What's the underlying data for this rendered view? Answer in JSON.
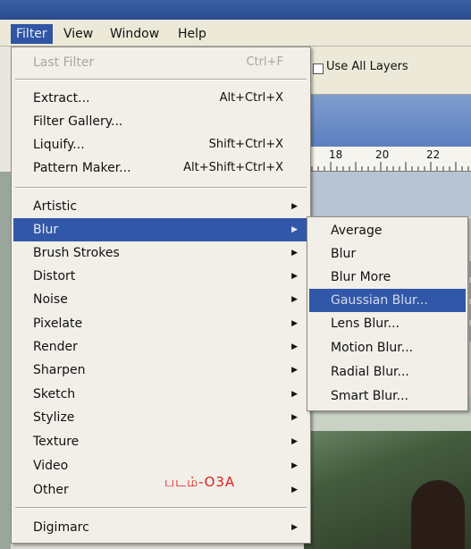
{
  "menubar": {
    "items": [
      "Filter",
      "View",
      "Window",
      "Help"
    ],
    "active": "Filter"
  },
  "options": {
    "use_all_layers": "Use All Layers"
  },
  "ruler": {
    "labels": [
      "18",
      "20",
      "22"
    ]
  },
  "filter_menu": {
    "last_filter": {
      "label": "Last Filter",
      "shortcut": "Ctrl+F"
    },
    "group1": [
      {
        "label": "Extract...",
        "shortcut": "Alt+Ctrl+X"
      },
      {
        "label": "Filter Gallery...",
        "shortcut": ""
      },
      {
        "label": "Liquify...",
        "shortcut": "Shift+Ctrl+X"
      },
      {
        "label": "Pattern Maker...",
        "shortcut": "Alt+Shift+Ctrl+X"
      }
    ],
    "group2": [
      {
        "label": "Artistic"
      },
      {
        "label": "Blur"
      },
      {
        "label": "Brush Strokes"
      },
      {
        "label": "Distort"
      },
      {
        "label": "Noise"
      },
      {
        "label": "Pixelate"
      },
      {
        "label": "Render"
      },
      {
        "label": "Sharpen"
      },
      {
        "label": "Sketch"
      },
      {
        "label": "Stylize"
      },
      {
        "label": "Texture"
      },
      {
        "label": "Video"
      },
      {
        "label": "Other"
      }
    ],
    "group3": [
      {
        "label": "Digimarc"
      }
    ]
  },
  "blur_submenu": {
    "items": [
      "Average",
      "Blur",
      "Blur More",
      "Gaussian Blur...",
      "Lens Blur...",
      "Motion Blur...",
      "Radial Blur...",
      "Smart Blur..."
    ],
    "highlighted": "Gaussian Blur..."
  },
  "caption": "படம்-O3A",
  "colors": {
    "highlight": "#3157a8",
    "menu_bg": "#f1efe8",
    "caption_red": "#e0201f"
  }
}
